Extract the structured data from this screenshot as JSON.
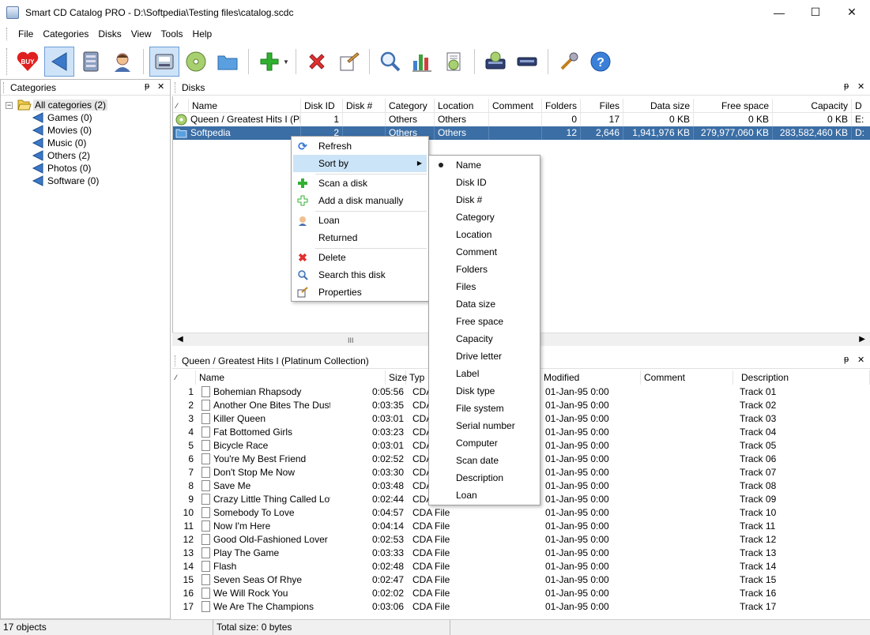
{
  "window": {
    "title": "Smart CD Catalog PRO - D:\\Softpedia\\Testing files\\catalog.scdc",
    "minimize": "—",
    "maximize": "☐",
    "close": "✕"
  },
  "menu": [
    "File",
    "Categories",
    "Disks",
    "View",
    "Tools",
    "Help"
  ],
  "toolbar_icons": [
    "buy-icon",
    "back-icon",
    "catalog-icon",
    "user-icon",
    "scan-icon",
    "disk-icon",
    "folder-icon",
    "add-icon",
    "delete-icon",
    "properties-icon",
    "search-icon",
    "chart-icon",
    "report-icon",
    "drive-icon",
    "eject-icon",
    "tools-icon",
    "help-icon"
  ],
  "categories_panel": {
    "title": "Categories",
    "pin": "ᵽ",
    "close": "✕",
    "items": [
      {
        "label": "All categories (2)"
      },
      {
        "label": "Games (0)"
      },
      {
        "label": "Movies (0)"
      },
      {
        "label": "Music (0)"
      },
      {
        "label": "Others (2)"
      },
      {
        "label": "Photos (0)"
      },
      {
        "label": "Software (0)"
      }
    ]
  },
  "disks_panel": {
    "title": "Disks",
    "columns": [
      "Name",
      "Disk ID",
      "Disk #",
      "Category",
      "Location",
      "Comment",
      "Folders",
      "Files",
      "Data size",
      "Free space",
      "Capacity",
      "D"
    ],
    "rows": [
      {
        "name": "Queen / Greatest Hits I (Pl...",
        "disk_id": "1",
        "disk_no": "",
        "category": "Others",
        "location": "Others",
        "comment": "",
        "folders": "0",
        "files": "17",
        "data_size": "0 KB",
        "free_space": "0 KB",
        "capacity": "0 KB",
        "drive": "E:"
      },
      {
        "name": "Softpedia",
        "disk_id": "2",
        "disk_no": "",
        "category": "Others",
        "location": "Others",
        "comment": "",
        "folders": "12",
        "files": "2,646",
        "data_size": "1,941,976 KB",
        "free_space": "279,977,060 KB",
        "capacity": "283,582,460 KB",
        "drive": "D:"
      }
    ],
    "scroll_thumb": "III"
  },
  "tracks_panel": {
    "title": "Queen / Greatest Hits I (Platinum  Collection)",
    "columns": [
      "Name",
      "Size",
      "Type",
      "Modified",
      "Comment",
      "Description"
    ],
    "type_header_visible": "Typ",
    "rows": [
      {
        "n": "1",
        "name": "Bohemian Rhapsody",
        "size": "0:05:56",
        "type": "CDA",
        "modified": "01-Jan-95 0:00",
        "desc": "Track 01"
      },
      {
        "n": "2",
        "name": "Another One Bites The Dust",
        "size": "0:03:35",
        "type": "CDA",
        "modified": "01-Jan-95 0:00",
        "desc": "Track 02"
      },
      {
        "n": "3",
        "name": "Killer Queen",
        "size": "0:03:01",
        "type": "CDA",
        "modified": "01-Jan-95 0:00",
        "desc": "Track 03"
      },
      {
        "n": "4",
        "name": "Fat Bottomed Girls",
        "size": "0:03:23",
        "type": "CDA",
        "modified": "01-Jan-95 0:00",
        "desc": "Track 04"
      },
      {
        "n": "5",
        "name": "Bicycle Race",
        "size": "0:03:01",
        "type": "CDA",
        "modified": "01-Jan-95 0:00",
        "desc": "Track 05"
      },
      {
        "n": "6",
        "name": "You're My Best Friend",
        "size": "0:02:52",
        "type": "CDA",
        "modified": "01-Jan-95 0:00",
        "desc": "Track 06"
      },
      {
        "n": "7",
        "name": "Don't Stop Me Now",
        "size": "0:03:30",
        "type": "CDA",
        "modified": "01-Jan-95 0:00",
        "desc": "Track 07"
      },
      {
        "n": "8",
        "name": "Save Me",
        "size": "0:03:48",
        "type": "CDA",
        "modified": "01-Jan-95 0:00",
        "desc": "Track 08"
      },
      {
        "n": "9",
        "name": "Crazy Little Thing Called Love",
        "size": "0:02:44",
        "type": "CDA",
        "modified": "01-Jan-95 0:00",
        "desc": "Track 09"
      },
      {
        "n": "10",
        "name": "Somebody To Love",
        "size": "0:04:57",
        "type": "CDA File",
        "modified": "01-Jan-95 0:00",
        "desc": "Track 10"
      },
      {
        "n": "11",
        "name": "Now I'm Here",
        "size": "0:04:14",
        "type": "CDA File",
        "modified": "01-Jan-95 0:00",
        "desc": "Track 11"
      },
      {
        "n": "12",
        "name": "Good Old-Fashioned Lover ...",
        "size": "0:02:53",
        "type": "CDA File",
        "modified": "01-Jan-95 0:00",
        "desc": "Track 12"
      },
      {
        "n": "13",
        "name": "Play The Game",
        "size": "0:03:33",
        "type": "CDA File",
        "modified": "01-Jan-95 0:00",
        "desc": "Track 13"
      },
      {
        "n": "14",
        "name": "Flash",
        "size": "0:02:48",
        "type": "CDA File",
        "modified": "01-Jan-95 0:00",
        "desc": "Track 14"
      },
      {
        "n": "15",
        "name": "Seven Seas Of Rhye",
        "size": "0:02:47",
        "type": "CDA File",
        "modified": "01-Jan-95 0:00",
        "desc": "Track 15"
      },
      {
        "n": "16",
        "name": "We Will Rock You",
        "size": "0:02:02",
        "type": "CDA File",
        "modified": "01-Jan-95 0:00",
        "desc": "Track 16"
      },
      {
        "n": "17",
        "name": "We Are The Champions",
        "size": "0:03:06",
        "type": "CDA File",
        "modified": "01-Jan-95 0:00",
        "desc": "Track 17"
      }
    ]
  },
  "context_menu": {
    "items": [
      {
        "label": "Refresh",
        "icon": "refresh-icon"
      },
      {
        "label": "Sort by",
        "icon": "",
        "submenu": true
      },
      {
        "label": "Scan a disk",
        "icon": "add-icon"
      },
      {
        "label": "Add a disk manually",
        "icon": "add-outline-icon"
      },
      {
        "label": "Loan",
        "icon": "user-icon"
      },
      {
        "label": "Returned",
        "icon": ""
      },
      {
        "label": "Delete",
        "icon": "delete-icon"
      },
      {
        "label": "Search this disk",
        "icon": "search-icon"
      },
      {
        "label": "Properties",
        "icon": "properties-icon"
      }
    ]
  },
  "sort_submenu": {
    "selected": "Name",
    "items": [
      "Name",
      "Disk ID",
      "Disk #",
      "Category",
      "Location",
      "Comment",
      "Folders",
      "Files",
      "Data size",
      "Free space",
      "Capacity",
      "Drive letter",
      "Label",
      "Disk type",
      "File system",
      "Serial number",
      "Computer",
      "Scan date",
      "Description",
      "Loan"
    ]
  },
  "status": {
    "objects": "17 objects",
    "total_size": "Total size: 0 bytes"
  },
  "colors": {
    "selection": "#3b6ea5",
    "menu_highlight": "#cce4f7",
    "folder_blue": "#3a78d8"
  }
}
